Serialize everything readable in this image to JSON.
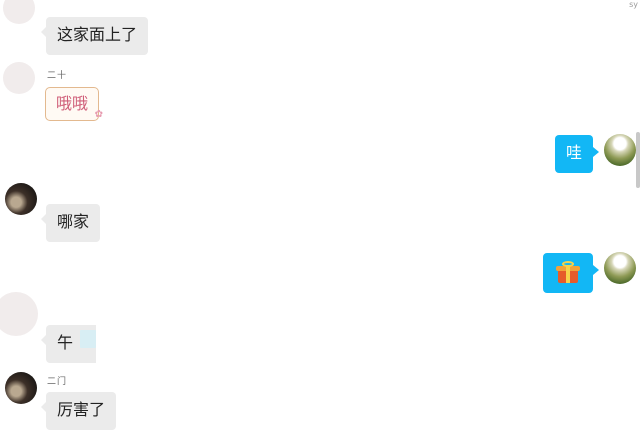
{
  "window": {
    "corner_mark": "sy"
  },
  "messages": [
    {
      "side": "left",
      "sender": "",
      "text": "这家面上了",
      "avatar": "blank"
    },
    {
      "side": "left",
      "sender": "二十",
      "text": "哦哦",
      "avatar": "blank",
      "style": "decorated-bubble"
    },
    {
      "side": "right",
      "text": "哇",
      "avatar": "green-photo"
    },
    {
      "side": "left",
      "sender": "",
      "text": "哪家",
      "avatar": "dark-photo"
    },
    {
      "side": "right",
      "text": "",
      "content": "gift-icon",
      "avatar": "green-photo"
    },
    {
      "side": "left",
      "sender": "",
      "text": "午",
      "avatar": "blank",
      "partially_obscured": true
    },
    {
      "side": "left",
      "sender": "二门",
      "text": "厉害了",
      "avatar": "dark-photo"
    }
  ],
  "colors": {
    "self_bubble": "#12b7f5",
    "other_bubble": "#ebebeb",
    "decorated_text": "#cf5d78",
    "decorated_border": "#e3b98f"
  }
}
